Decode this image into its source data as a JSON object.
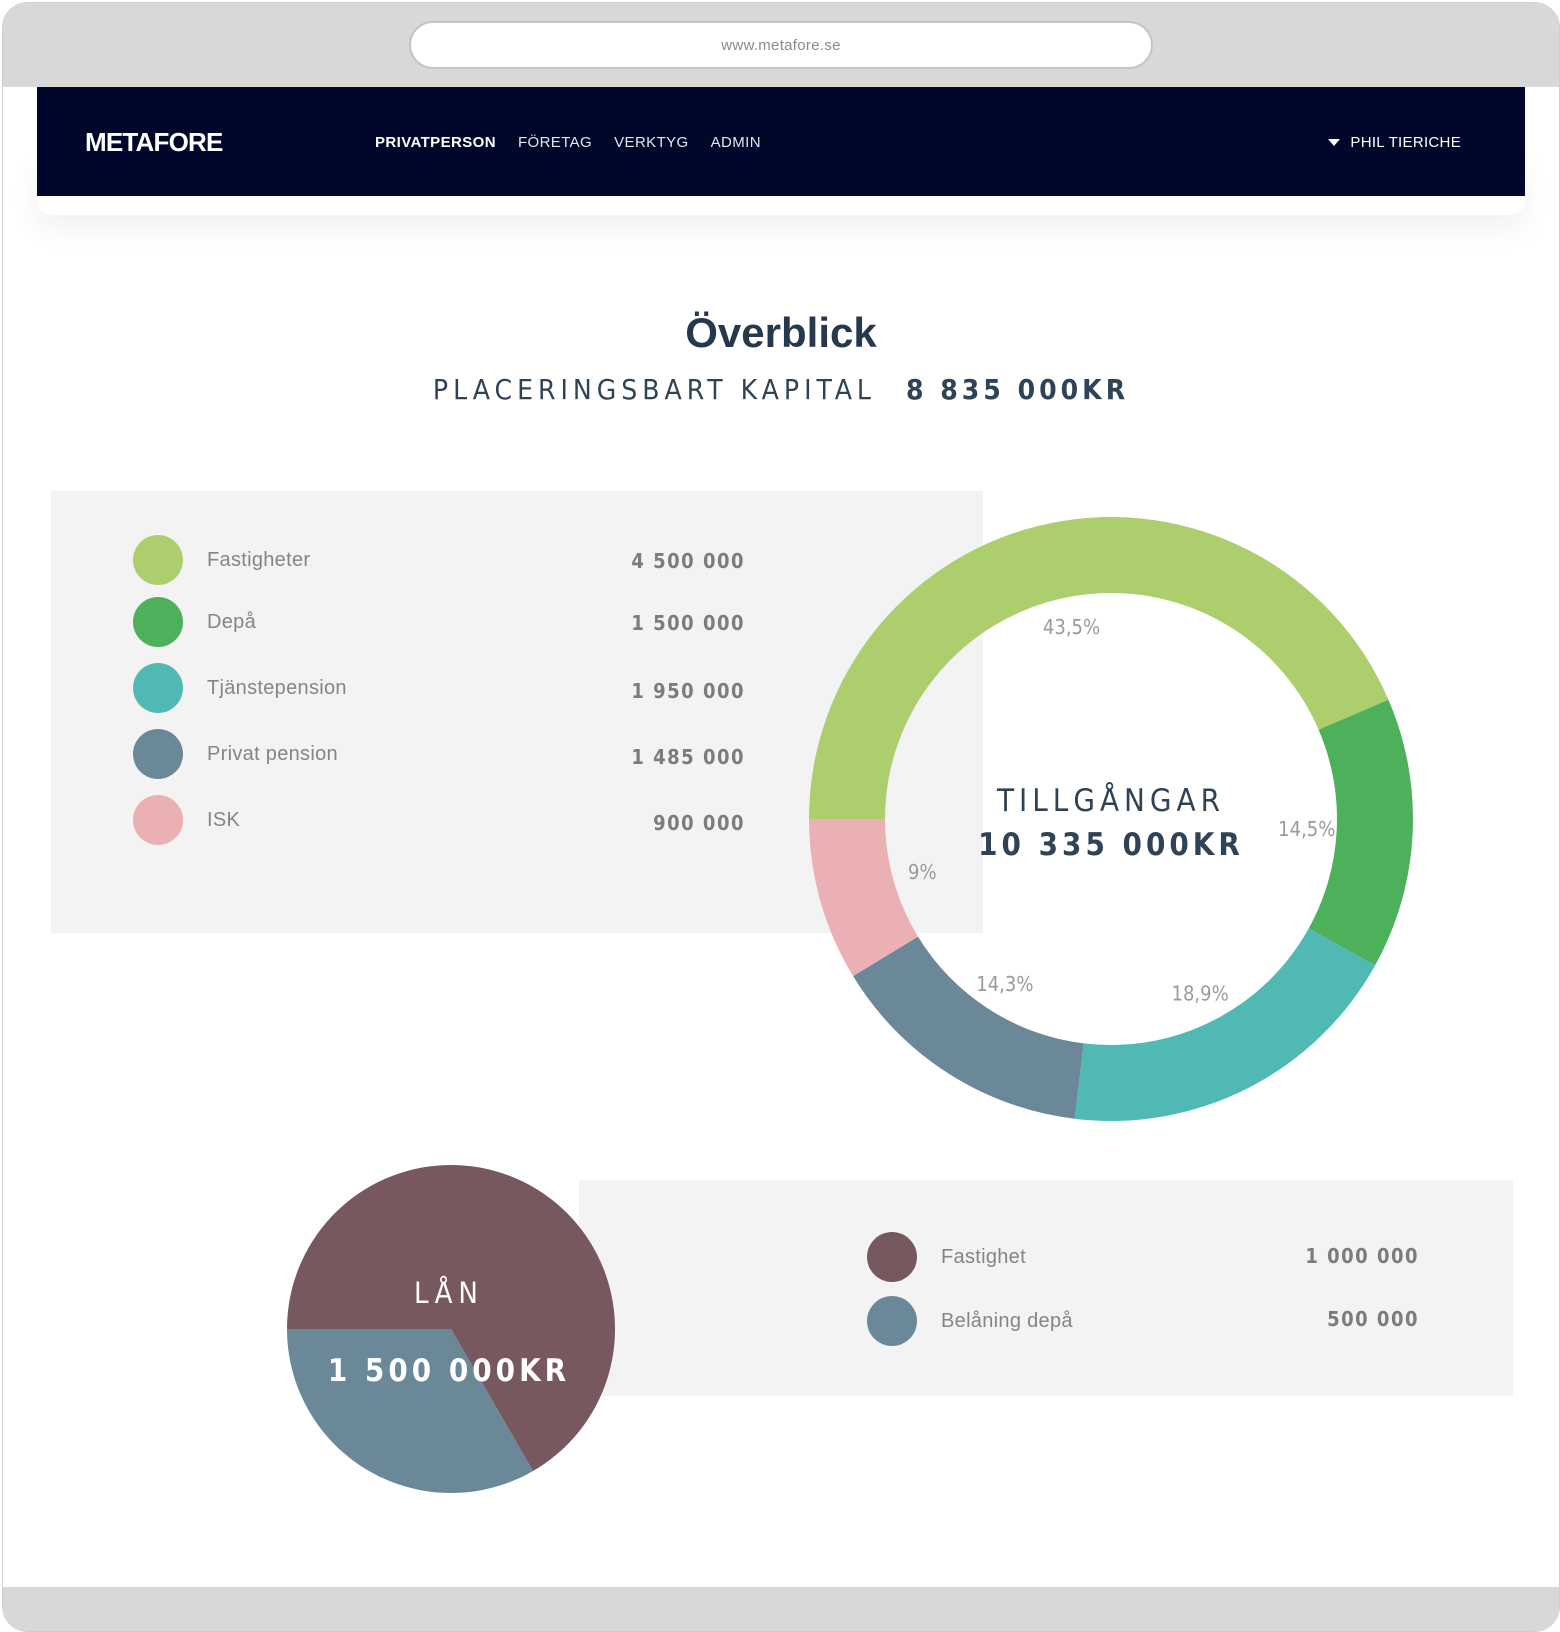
{
  "browser": {
    "url": "www.metafore.se"
  },
  "nav": {
    "logo": "METAFORE",
    "links": [
      "PRIVATPERSON",
      "FÖRETAG",
      "VERKTYG",
      "ADMIN"
    ],
    "active_link": "PRIVATPERSON",
    "user": "PHIL TIERICHE",
    "user_icon": "caret-down-icon"
  },
  "overview": {
    "title": "Överblick",
    "capital_label": "PLACERINGSBART KAPITAL",
    "capital_value": "8 835 000KR"
  },
  "assets": {
    "items": [
      {
        "label": "Fastigheter",
        "value": "4 500 000",
        "color": "#acce6c"
      },
      {
        "label": "Depå",
        "value": "1 500 000",
        "color": "#4cb15a"
      },
      {
        "label": "Tjänstepension",
        "value": "1 950 000",
        "color": "#51b9b3"
      },
      {
        "label": "Privat pension",
        "value": "1 485 000",
        "color": "#6b8898"
      },
      {
        "label": "ISK",
        "value": "900 000",
        "color": "#ebb0b3"
      }
    ]
  },
  "loans": {
    "items": [
      {
        "label": "Fastighet",
        "value": "1 000 000",
        "color": "#76585e"
      },
      {
        "label": "Belåning depå",
        "value": "500 000",
        "color": "#6b8898"
      }
    ]
  },
  "chart_data": [
    {
      "type": "pie",
      "variant": "donut",
      "center_label": "TILLGÅNGAR",
      "center_value": "10 335 000KR",
      "categories": [
        "Fastigheter",
        "Depå",
        "Tjänstepension",
        "Privat pension",
        "ISK"
      ],
      "values": [
        4500000,
        1500000,
        1950000,
        1485000,
        900000
      ],
      "percent_labels": [
        "43,5%",
        "14,5%",
        "18,9%",
        "14,3%",
        "9%"
      ],
      "colors": [
        "#acce6c",
        "#4cb15a",
        "#51b9b3",
        "#6b8898",
        "#ebb0b3"
      ],
      "start": "left, clockwise"
    },
    {
      "type": "pie",
      "center_label": "LÅN",
      "center_value": "1 500 000KR",
      "categories": [
        "Fastighet",
        "Belåning depå"
      ],
      "values": [
        1000000,
        500000
      ],
      "colors": [
        "#76585e",
        "#6b8898"
      ]
    }
  ]
}
